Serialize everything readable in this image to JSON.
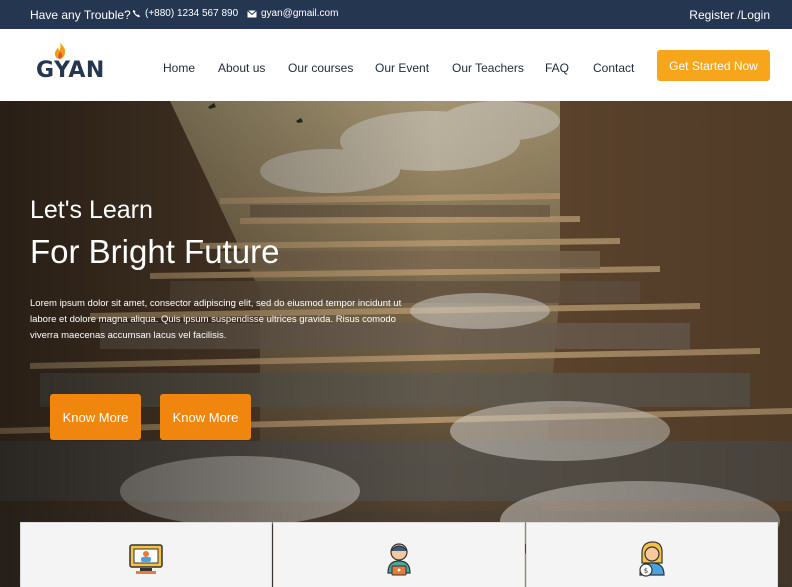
{
  "topbar": {
    "trouble": "Have any Trouble?",
    "phone": "(+880) 1234 567 890",
    "email": "gyan@gmail.com",
    "login": "Register /Login"
  },
  "brand": {
    "name": "GYAN"
  },
  "nav": {
    "home": "Home",
    "about": "About us",
    "courses": "Our courses",
    "event": "Our Event",
    "teachers": "Our Teachers",
    "faq": "FAQ",
    "contact": "Contact"
  },
  "cta": "Get Started Now",
  "hero": {
    "line1": "Let's Learn",
    "line2": "For Bright Future",
    "paragraph": "Lorem ipsum dolor sit amet, consector adipiscing elit, sed do eiusmod tempor incidunt ut labore et dolore magna aliqua. Quis ipsum suspendisse ultrices gravida. Risus comodo viverra maecenas accumsan lacus vel facilisis.",
    "btn1": "Know More",
    "btn2": "Know More"
  },
  "colors": {
    "topbar": "#243650",
    "accent": "#f7a61c",
    "hero_button": "#f0860e"
  },
  "icons": [
    "phone-icon",
    "envelope-icon",
    "flame-icon",
    "computer-teacher-icon",
    "support-agent-icon",
    "student-icon"
  ]
}
